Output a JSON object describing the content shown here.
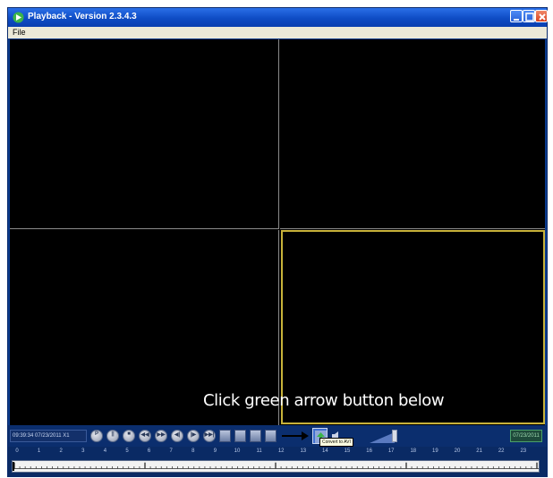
{
  "window": {
    "title": "Playback - Version 2.3.4.3"
  },
  "menu": {
    "file": "File"
  },
  "instruction": "Click green arrow button below",
  "controls": {
    "time_readout": "09:39:34 07/23/2011  X1",
    "playback_buttons": [
      "P",
      "||",
      "■",
      "◀◀",
      "▶▶",
      "◀|",
      "|▶",
      "▶▶|"
    ],
    "tool_buttons": [
      "snapshot",
      "record",
      "clip",
      "film"
    ],
    "convert_tooltip": "Convert to AVI",
    "date_readout": "07/23/2011"
  },
  "timeline": {
    "hours": [
      "0",
      "1",
      "2",
      "3",
      "4",
      "5",
      "6",
      "7",
      "8",
      "9",
      "10",
      "11",
      "12",
      "13",
      "14",
      "15",
      "16",
      "17",
      "18",
      "19",
      "20",
      "21",
      "22",
      "23"
    ]
  },
  "colors": {
    "window_frame": "#0a3a8c",
    "selected_pane_border": "#c8b23a",
    "convert_accent": "#3cb44a"
  }
}
